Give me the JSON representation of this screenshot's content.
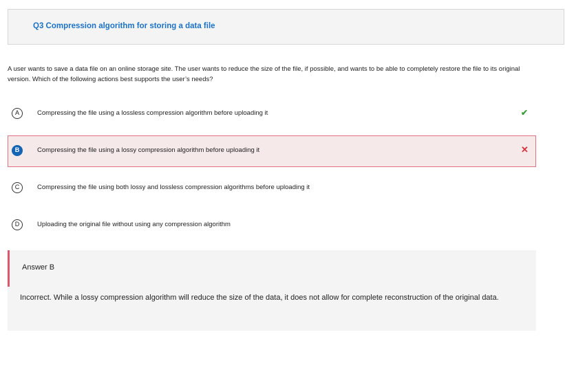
{
  "header": {
    "title": "Q3 Compression algorithm for storing a data file"
  },
  "question": {
    "text": "A user wants to save a data file on an online storage site. The user wants to reduce the size of the file, if possible, and wants to be able to completely restore the file to its original version. Which of the following actions best supports the user’s needs?"
  },
  "options": [
    {
      "letter": "A",
      "text": "Compressing the file using a lossless compression algorithm before uploading it",
      "status": "correct",
      "mark": "✔"
    },
    {
      "letter": "B",
      "text": "Compressing the file using a lossy compression algorithm before uploading it",
      "status": "selected-incorrect",
      "mark": "✕"
    },
    {
      "letter": "C",
      "text": "Compressing the file using both lossy and lossless compression algorithms before uploading it",
      "status": "none"
    },
    {
      "letter": "D",
      "text": "Uploading the original file without using any compression algorithm",
      "status": "none"
    }
  ],
  "answer": {
    "label": "Answer B",
    "explanation": "Incorrect. While a lossy compression algorithm will reduce the size of the data, it does not allow for complete reconstruction of the original data."
  },
  "colors": {
    "title_blue": "#1a73c9",
    "selected_bg": "#f6e9e9",
    "selected_border": "#e0737f",
    "check_green": "#3a9e3a",
    "cross_red": "#d8343f",
    "badge_blue": "#1565b4",
    "accent_red": "#e0566a"
  },
  "icons": {
    "correct": "check-icon",
    "incorrect": "cross-icon"
  }
}
